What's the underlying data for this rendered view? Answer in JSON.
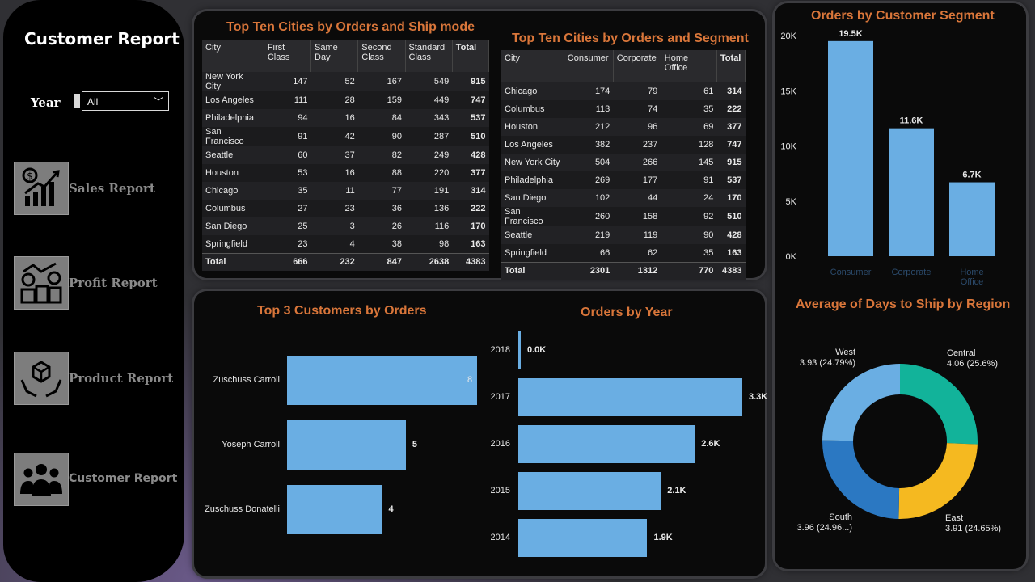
{
  "sidebar": {
    "title": "Customer Report",
    "year_label": "Year",
    "year_value": "All",
    "nav": [
      {
        "label": "Sales Report",
        "icon": "sales-chart-icon"
      },
      {
        "label": "Profit Report",
        "icon": "profit-coins-icon"
      },
      {
        "label": "Product Report",
        "icon": "product-box-icon"
      },
      {
        "label": "Customer Report",
        "icon": "customers-group-icon"
      }
    ]
  },
  "ship_table": {
    "title": "Top Ten Cities by Orders and Ship mode",
    "headers": [
      "City",
      "First Class",
      "Same Day",
      "Second Class",
      "Standard Class",
      "Total"
    ],
    "rows": [
      [
        "New York City",
        "147",
        "52",
        "167",
        "549",
        "915"
      ],
      [
        "Los Angeles",
        "111",
        "28",
        "159",
        "449",
        "747"
      ],
      [
        "Philadelphia",
        "94",
        "16",
        "84",
        "343",
        "537"
      ],
      [
        "San Francisco",
        "91",
        "42",
        "90",
        "287",
        "510"
      ],
      [
        "Seattle",
        "60",
        "37",
        "82",
        "249",
        "428"
      ],
      [
        "Houston",
        "53",
        "16",
        "88",
        "220",
        "377"
      ],
      [
        "Chicago",
        "35",
        "11",
        "77",
        "191",
        "314"
      ],
      [
        "Columbus",
        "27",
        "23",
        "36",
        "136",
        "222"
      ],
      [
        "San Diego",
        "25",
        "3",
        "26",
        "116",
        "170"
      ],
      [
        "Springfield",
        "23",
        "4",
        "38",
        "98",
        "163"
      ]
    ],
    "total": [
      "Total",
      "666",
      "232",
      "847",
      "2638",
      "4383"
    ]
  },
  "segment_table": {
    "title": "Top Ten Cities by Orders and Segment",
    "headers": [
      "City",
      "Consumer",
      "Corporate",
      "Home Office",
      "Total"
    ],
    "rows": [
      [
        "Chicago",
        "174",
        "79",
        "61",
        "314"
      ],
      [
        "Columbus",
        "113",
        "74",
        "35",
        "222"
      ],
      [
        "Houston",
        "212",
        "96",
        "69",
        "377"
      ],
      [
        "Los Angeles",
        "382",
        "237",
        "128",
        "747"
      ],
      [
        "New York City",
        "504",
        "266",
        "145",
        "915"
      ],
      [
        "Philadelphia",
        "269",
        "177",
        "91",
        "537"
      ],
      [
        "San Diego",
        "102",
        "44",
        "24",
        "170"
      ],
      [
        "San Francisco",
        "260",
        "158",
        "92",
        "510"
      ],
      [
        "Seattle",
        "219",
        "119",
        "90",
        "428"
      ],
      [
        "Springfield",
        "66",
        "62",
        "35",
        "163"
      ]
    ],
    "total": [
      "Total",
      "2301",
      "1312",
      "770",
      "4383"
    ]
  },
  "chart_data": [
    {
      "type": "bar",
      "title": "Top 3 Customers by Orders",
      "orientation": "horizontal",
      "categories": [
        "Zuschuss Carroll",
        "Yoseph Carroll",
        "Zuschuss Donatelli"
      ],
      "values": [
        8,
        5,
        4
      ],
      "data_labels": [
        "8",
        "5",
        "4"
      ]
    },
    {
      "type": "bar",
      "title": "Orders by Year",
      "orientation": "horizontal",
      "categories": [
        "2018",
        "2017",
        "2016",
        "2015",
        "2014"
      ],
      "values": [
        0.03,
        3.3,
        2.6,
        2.1,
        1.9
      ],
      "data_labels": [
        "0.0K",
        "3.3K",
        "2.6K",
        "2.1K",
        "1.9K"
      ]
    },
    {
      "type": "bar",
      "title": "Orders by Customer Segment",
      "categories": [
        "Consumer",
        "Corporate",
        "Home Office"
      ],
      "values": [
        19.5,
        11.6,
        6.7
      ],
      "data_labels": [
        "19.5K",
        "11.6K",
        "6.7K"
      ],
      "yticks": [
        "0K",
        "5K",
        "10K",
        "15K",
        "20K"
      ],
      "ylim": [
        0,
        20
      ]
    },
    {
      "type": "pie",
      "title": "Average of Days to Ship by Region",
      "donut": true,
      "slices": [
        {
          "label": "Central",
          "value": 4.06,
          "text": "4.06 (25.6%)",
          "color": "#12b39a"
        },
        {
          "label": "East",
          "value": 3.91,
          "text": "3.91 (24.65%)",
          "color": "#f5b920"
        },
        {
          "label": "South",
          "value": 3.96,
          "text": "3.96 (24.96...)",
          "color": "#2b78c2"
        },
        {
          "label": "West",
          "value": 3.93,
          "text": "3.93 (24.79%)",
          "color": "#6aaee3"
        }
      ]
    }
  ],
  "colors": {
    "accent": "#d9763a",
    "bar": "#6aaee3"
  }
}
